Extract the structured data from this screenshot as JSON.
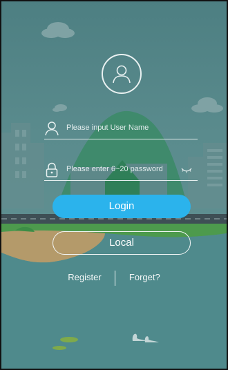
{
  "login_form": {
    "username_placeholder": "Please input User Name",
    "password_placeholder": "Please enter 6~20 password",
    "login_label": "Login",
    "local_label": "Local",
    "register_label": "Register",
    "forget_label": "Forget?"
  },
  "icons": {
    "avatar": "user-avatar-icon",
    "username": "user-icon",
    "password": "lock-icon",
    "toggle_password": "eye-closed-icon"
  },
  "colors": {
    "background": "#4f8a8c",
    "login_button": "#2bb3ec",
    "text_light": "#e3eded"
  }
}
